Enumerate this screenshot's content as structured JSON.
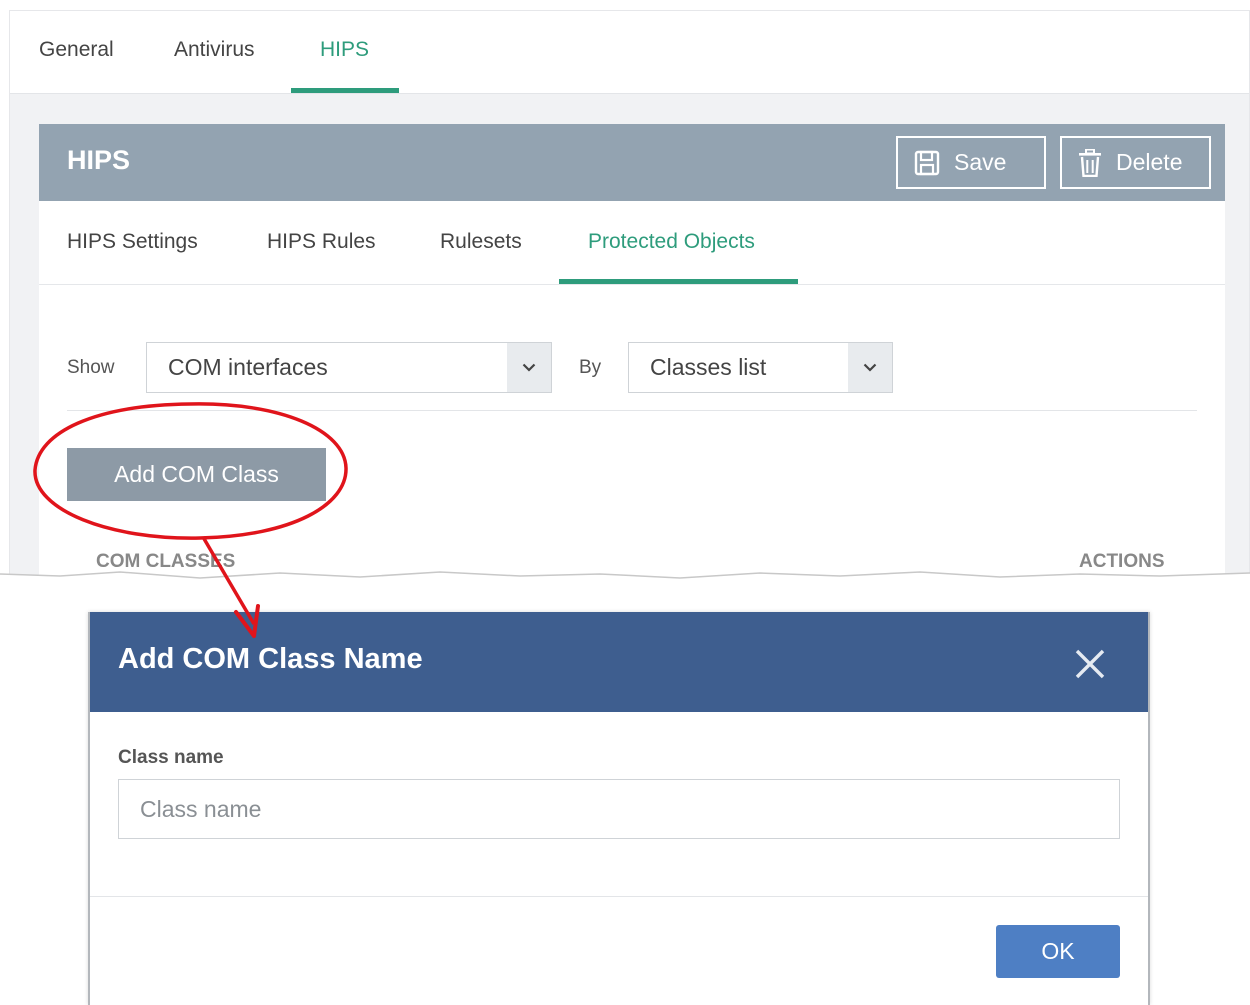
{
  "main_tabs": [
    {
      "label": "General",
      "active": false
    },
    {
      "label": "Antivirus",
      "active": false
    },
    {
      "label": "HIPS",
      "active": true
    }
  ],
  "panel": {
    "title": "HIPS",
    "save_label": "Save",
    "delete_label": "Delete"
  },
  "sub_tabs": [
    {
      "label": "HIPS Settings",
      "active": false
    },
    {
      "label": "HIPS Rules",
      "active": false
    },
    {
      "label": "Rulesets",
      "active": false
    },
    {
      "label": "Protected Objects",
      "active": true
    }
  ],
  "filters": {
    "show_label": "Show",
    "show_value": "COM interfaces",
    "by_label": "By",
    "by_value": "Classes list"
  },
  "add_button_label": "Add COM Class",
  "table": {
    "col_classes": "COM CLASSES",
    "col_actions": "ACTIONS"
  },
  "dialog": {
    "title": "Add COM Class Name",
    "field_label": "Class name",
    "field_placeholder": "Class name",
    "field_value": "",
    "ok_label": "OK"
  },
  "colors": {
    "accent_green": "#2e9c7c",
    "panel_header": "#93a3b1",
    "dialog_header": "#3e5e8f",
    "ok_button": "#4e7fc4",
    "annotation_red": "#e0141b"
  },
  "icons": {
    "save": "floppy-disk-icon",
    "delete": "trash-icon",
    "caret": "chevron-down-icon",
    "close": "close-icon"
  }
}
